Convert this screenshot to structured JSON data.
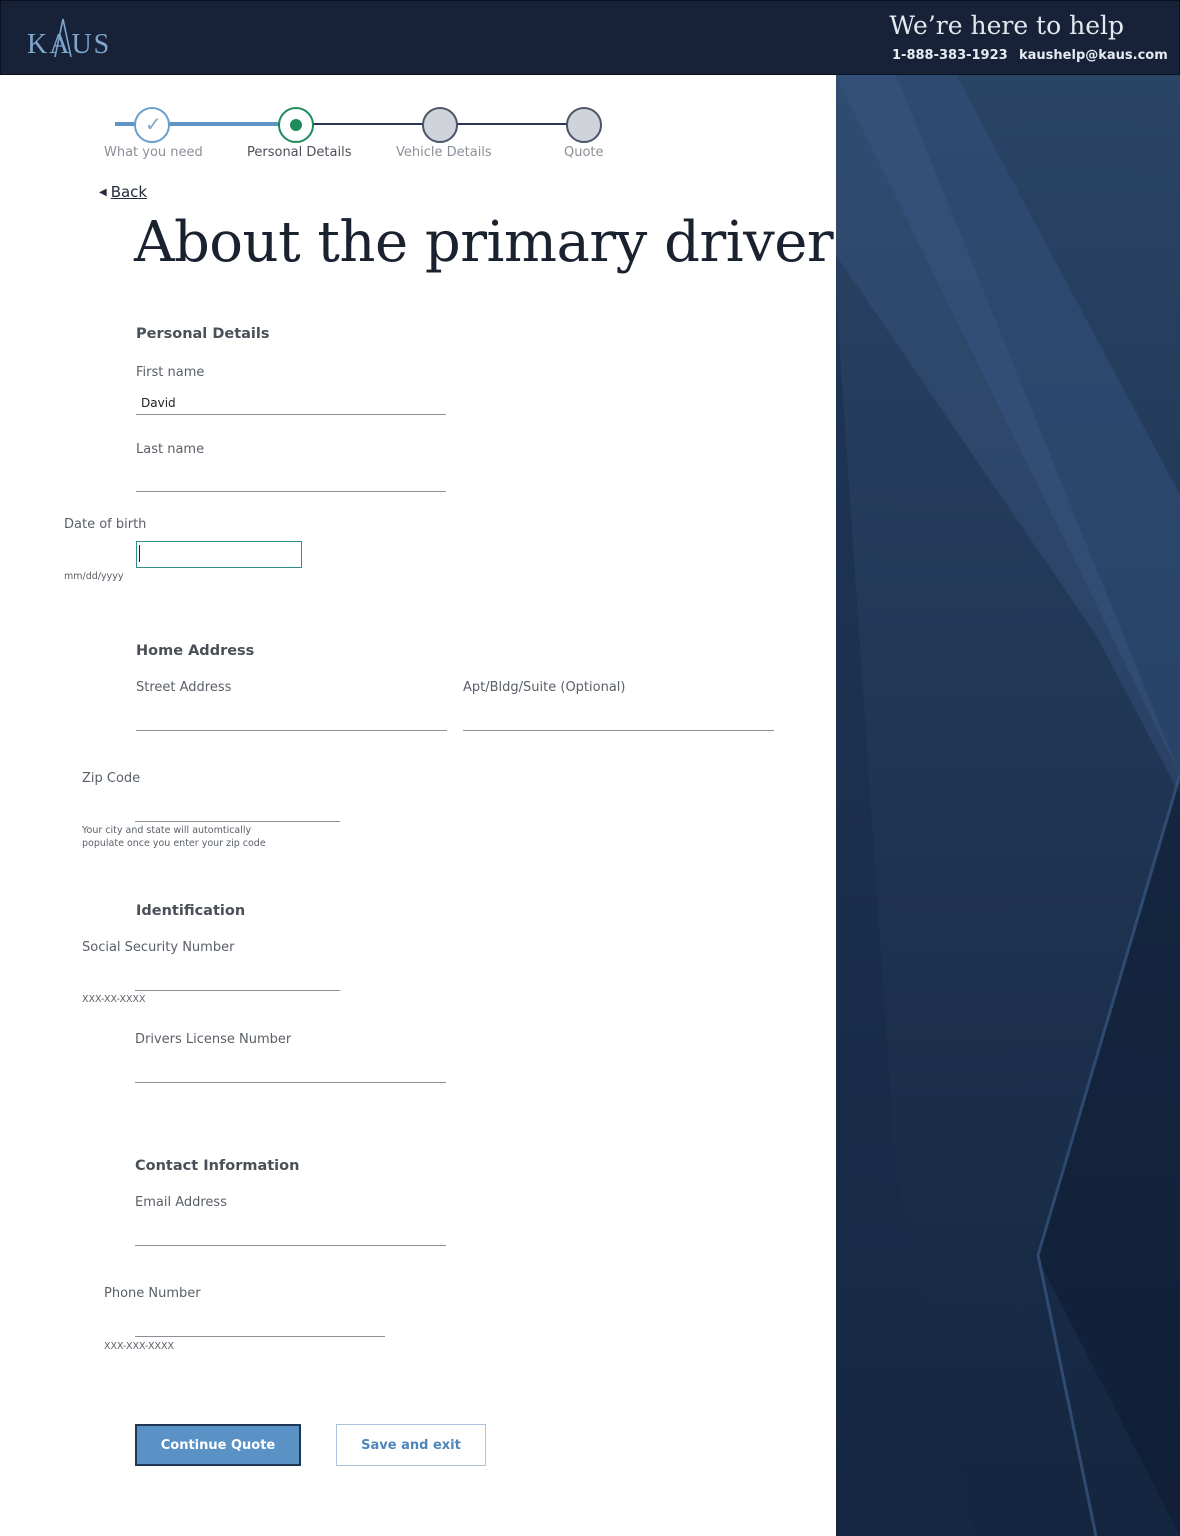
{
  "header": {
    "logo_text": "KAUS",
    "help_title": "We’re here to help",
    "phone": "1-888-383-1923",
    "email": "kaushelp@kaus.com"
  },
  "stepper": {
    "steps": [
      {
        "label": "What you need",
        "state": "complete"
      },
      {
        "label": "Personal Details",
        "state": "active"
      },
      {
        "label": "Vehicle Details",
        "state": "upcoming"
      },
      {
        "label": "Quote",
        "state": "upcoming"
      }
    ]
  },
  "back_label": "Back",
  "page_title": "About the primary driver",
  "personal": {
    "heading": "Personal Details",
    "first_name_label": "First name",
    "first_name_value": "David",
    "last_name_label": "Last name",
    "last_name_value": "",
    "dob_label": "Date of birth",
    "dob_value": "",
    "dob_hint": "mm/dd/yyyy"
  },
  "address": {
    "heading": "Home Address",
    "street_label": "Street Address",
    "apt_label": "Apt/Bldg/Suite (Optional)",
    "zip_label": "Zip Code",
    "zip_hint_line1": "Your city and state will automtically",
    "zip_hint_line2": "populate once you enter your zip code"
  },
  "identification": {
    "heading": "Identification",
    "ssn_label": "Social Security Number",
    "ssn_hint": "XXX-XX-XXXX",
    "license_label": "Drivers License Number"
  },
  "contact": {
    "heading": "Contact Information",
    "email_label": "Email Address",
    "phone_label": "Phone Number",
    "phone_hint": "XXX-XXX-XXXX"
  },
  "buttons": {
    "continue": "Continue Quote",
    "save_exit": "Save and exit"
  },
  "colors": {
    "header_bg": "#172238",
    "accent_blue": "#5a92c6",
    "active_green": "#1f8a5a",
    "panel_bg": "#1c3150"
  }
}
